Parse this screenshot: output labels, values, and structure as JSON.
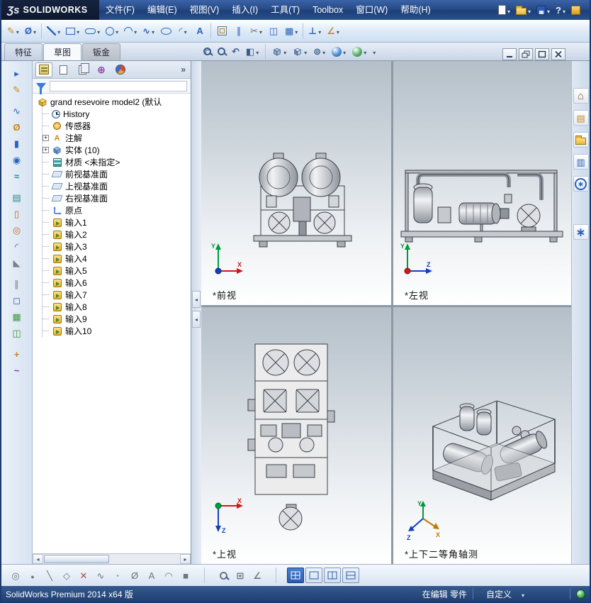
{
  "titlebar": {
    "brand_mark": "Ʒs",
    "brand": "SOLIDWORKS",
    "menus": [
      "文件(F)",
      "编辑(E)",
      "视图(V)",
      "插入(I)",
      "工具(T)",
      "Toolbox",
      "窗口(W)",
      "帮助(H)"
    ],
    "quick_icons": [
      "new-document",
      "open",
      "save",
      "help",
      "solidworks-resources"
    ]
  },
  "main_toolbar": {
    "icons": [
      "sketch",
      "smart-dimension",
      "line",
      "corner-rectangle",
      "straight-slot",
      "circle",
      "perimeter-circle",
      "spline",
      "ellipse",
      "sketch-fillet",
      "sketch-text",
      "convert-entities",
      "offset-entities",
      "trim-entities",
      "mirror-entities",
      "linear-sketch-pattern",
      "display-delete-relations",
      "quick-snaps"
    ]
  },
  "command_tabs": {
    "items": [
      "特征",
      "草图",
      "钣金"
    ],
    "active": "草图"
  },
  "panel": {
    "tabs": [
      "featuremanager-design-tree",
      "propertymanager",
      "configurationmanager",
      "dimxpertmanager",
      "displaymanager"
    ],
    "overflow": "»"
  },
  "feature_tree": {
    "root": "grand resevoire model2 (默认",
    "items": [
      {
        "label": "History"
      },
      {
        "label": "传感器"
      },
      {
        "label": "注解"
      },
      {
        "label": "实体 (10)"
      },
      {
        "label": "材质 <未指定>"
      },
      {
        "label": "前视基准面"
      },
      {
        "label": "上视基准面"
      },
      {
        "label": "右视基准面"
      },
      {
        "label": "原点"
      },
      {
        "label": "输入1"
      },
      {
        "label": "输入2"
      },
      {
        "label": "输入3"
      },
      {
        "label": "输入4"
      },
      {
        "label": "输入5"
      },
      {
        "label": "输入6"
      },
      {
        "label": "输入7"
      },
      {
        "label": "输入8"
      },
      {
        "label": "输入9"
      },
      {
        "label": "输入10"
      }
    ]
  },
  "headsup": {
    "icons": [
      "zoom-to-fit",
      "zoom-to-area",
      "previous-view",
      "section-view",
      "view-orientation",
      "display-style",
      "hide-show-items",
      "edit-appearance",
      "apply-scene",
      "view-settings"
    ]
  },
  "window_buttons": [
    "minimize",
    "restore",
    "maximize",
    "close"
  ],
  "right_toolbar": {
    "icons": [
      "home",
      "design-library",
      "file-explorer",
      "view-palette",
      "appearances",
      "custom-properties"
    ]
  },
  "left_toolbar": {
    "icons": [
      "select",
      "sketch",
      "3d-sketch",
      "smart-dimension",
      "extruded-boss-base",
      "revolved-boss-base",
      "swept-boss-base",
      "lofted-boss-base",
      "extruded-cut",
      "revolved-cut",
      "fillet",
      "chamfer",
      "rib",
      "shell",
      "linear-pattern",
      "mirror",
      "reference-geometry",
      "curves"
    ]
  },
  "viewports": [
    {
      "label": "*前视",
      "axis_v": "Y",
      "axis_h": "X"
    },
    {
      "label": "*左视",
      "axis_v": "Y",
      "axis_h": "Z"
    },
    {
      "label": "*上视",
      "axis_h": "X",
      "axis_d": "Z"
    },
    {
      "label": "*上下二等角轴测",
      "axis_v": "Y",
      "axis_h": "X",
      "axis_d": "Z"
    }
  ],
  "bottom_toolbar": {
    "filter_icons": [
      "toggle-selection-filters",
      "filter-vertices",
      "filter-edges",
      "filter-faces",
      "clear-all-filters",
      "filter-sketch-segments",
      "filter-midpoints",
      "filter-dimensions",
      "filter-annotations",
      "filter-surface-bodies",
      "filter-solid-bodies"
    ],
    "view_tools": [
      "magnified-selection",
      "grid-settings",
      "snap-settings"
    ],
    "layout_buttons": [
      "four-view",
      "single-view",
      "two-view-horizontal",
      "two-view-vertical"
    ],
    "active_layout": "four-view"
  },
  "statusbar": {
    "product": "SolidWorks Premium 2014 x64 版",
    "mode": "在编辑 零件",
    "custom": "自定义"
  }
}
